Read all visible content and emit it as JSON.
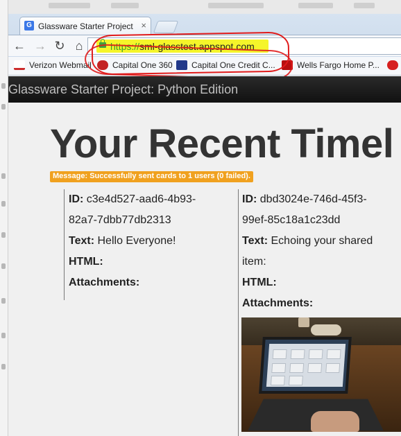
{
  "browser": {
    "tab_title": "Glassware Starter Project",
    "tab_icon": "G",
    "url_scheme": "https://",
    "url_host": "sml-glasstest.appspot.com",
    "bookmarks": [
      {
        "label": "Verizon Webmail",
        "icon": "verizon-icon",
        "color": "#cc2b2b"
      },
      {
        "label": "Capital One 360",
        "icon": "capital-one-360-icon",
        "color": "#c32323"
      },
      {
        "label": "Capital One Credit C...",
        "icon": "capital-one-icon",
        "color": "#22398a"
      },
      {
        "label": "Wells Fargo Home P...",
        "icon": "wells-fargo-icon",
        "color": "#b80f0f"
      }
    ]
  },
  "app": {
    "brand": "Glassware Starter Project: Python Edition",
    "heading": "Your Recent Timel",
    "message": "Message: Successfully sent cards to 1 users (0 failed)."
  },
  "cards": [
    {
      "id_label": "ID:",
      "id_value_1": "c3e4d527-aad6-4b93-",
      "id_value_2": "82a7-7dbb77db2313",
      "text_label": "Text:",
      "text_value": "Hello Everyone!",
      "html_label": "HTML:",
      "attachments_label": "Attachments:"
    },
    {
      "id_label": "ID:",
      "id_value_1": "dbd3024e-746d-45f3-",
      "id_value_2": "99ef-85c18a1c23dd",
      "text_label": "Text:",
      "text_value_1": "Echoing your shared",
      "text_value_2": "item:",
      "html_label": "HTML:",
      "attachments_label": "Attachments:"
    }
  ],
  "colors": {
    "accent_message": "#f0a11f",
    "header_bar": "#1a1a1a",
    "annotation": "#e01b1b",
    "url_highlight": "#f5f52a"
  }
}
